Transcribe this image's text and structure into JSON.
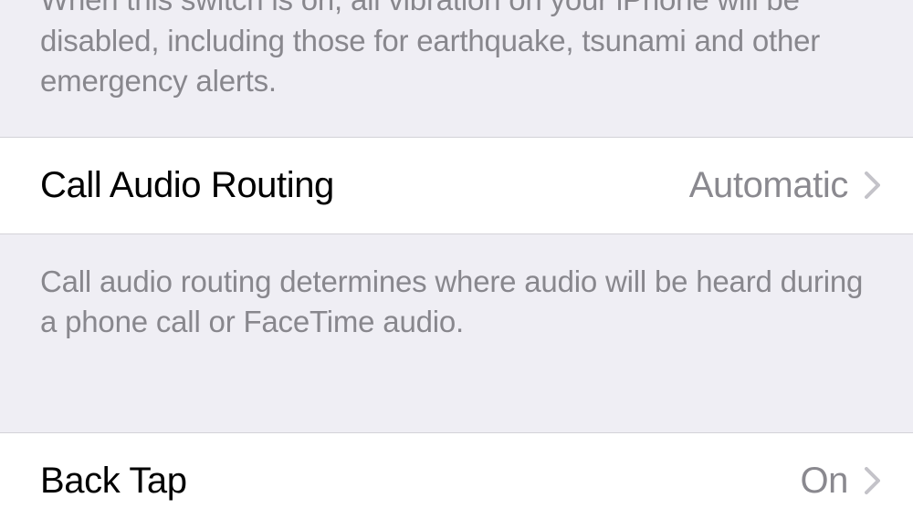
{
  "section1": {
    "description": "When this switch is on, all vibration on your iPhone will be disabled, including those for earthquake, tsunami and other emergency alerts."
  },
  "section2": {
    "row": {
      "label": "Call Audio Routing",
      "value": "Automatic"
    },
    "description": "Call audio routing determines where audio will be heard during a phone call or FaceTime audio."
  },
  "section3": {
    "row": {
      "label": "Back Tap",
      "value": "On"
    }
  }
}
